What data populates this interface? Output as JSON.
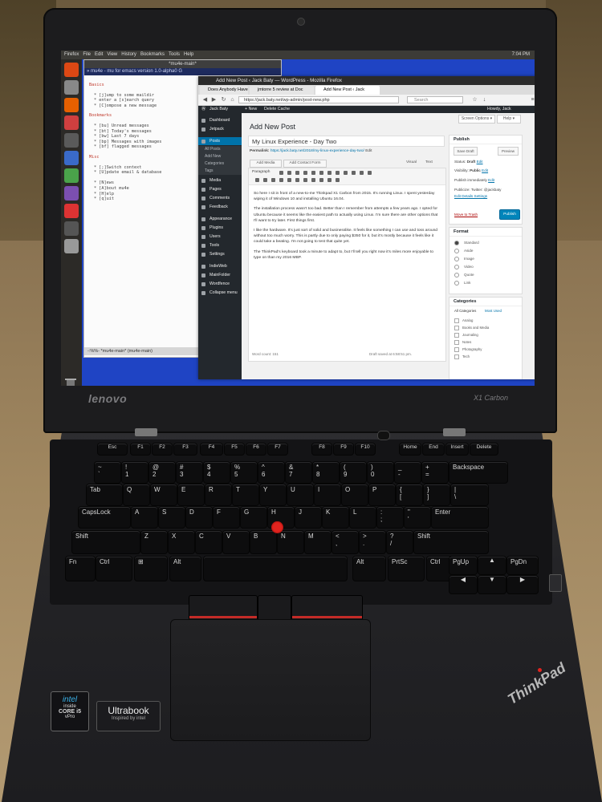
{
  "ubuntu": {
    "menu": [
      "Firefox",
      "File",
      "Edit",
      "View",
      "History",
      "Bookmarks",
      "Tools",
      "Help"
    ],
    "clock": "7:04 PM"
  },
  "emacs": {
    "title": "*mu4e-main*",
    "modeline_top": "» mu4e - mu for emacs version 1.0-alpha0 G",
    "basics_header": "Basics",
    "basics": [
      "* [j]ump to some maildir",
      "* enter a [s]earch query",
      "* [C]ompose a new message"
    ],
    "bookmarks_header": "Bookmarks",
    "bookmarks": [
      "* [bu] Unread messages",
      "* [bt] Today's messages",
      "* [bw] Last 7 days",
      "* [bp] Messages with images",
      "* [bf] flagged messages"
    ],
    "misc_header": "Misc",
    "misc": [
      "* [;]Switch context",
      "* [U]pdate email & database",
      "",
      "* [N]ews",
      "* [A]bout mu4e",
      "* [H]elp",
      "* [q]uit"
    ],
    "modeline_bottom": "-:%%-  *mu4e-main*     (mu4e-main)"
  },
  "firefox": {
    "window_title": "Add New Post ‹ Jack Baty — WordPress - Mozilla Firefox",
    "tabs": [
      "Does Anybody Have",
      "jmtorre 5 review at Doc",
      "Add New Post ‹ Jack"
    ],
    "url": "https://jack.baty.net/wp-admin/post-new.php",
    "search_placeholder": "Search"
  },
  "wp": {
    "adminbar": {
      "site": "Jack Baty",
      "new": "+ New",
      "delete": "Delete Cache",
      "howdy": "Howdy, Jack"
    },
    "sidebar": [
      {
        "label": "Dashboard",
        "active": false
      },
      {
        "label": "Jetpack",
        "active": false
      },
      {
        "label": "Posts",
        "active": true
      },
      {
        "label": "Media",
        "active": false
      },
      {
        "label": "Pages",
        "active": false
      },
      {
        "label": "Comments",
        "active": false
      },
      {
        "label": "Feedback",
        "active": false
      },
      {
        "label": "Appearance",
        "active": false
      },
      {
        "label": "Plugins",
        "active": false
      },
      {
        "label": "Users",
        "active": false
      },
      {
        "label": "Tools",
        "active": false
      },
      {
        "label": "Settings",
        "active": false
      },
      {
        "label": "IndieWeb",
        "active": false
      },
      {
        "label": "MainFolder",
        "active": false
      },
      {
        "label": "Wordfence",
        "active": false
      },
      {
        "label": "Collapse menu",
        "active": false
      }
    ],
    "posts_sub": [
      "All Posts",
      "Add New",
      "Categories",
      "Tags"
    ],
    "screen_options": "Screen Options ▾",
    "help": "Help ▾",
    "page_title": "Add New Post",
    "post_title": "My Linux Experience - Day Two",
    "permalink_label": "Permalink:",
    "permalink_url": "https://jack.baty.net/2018/my-linux-experience-day-two/",
    "permalink_edit": "Edit",
    "add_media": "Add Media",
    "add_contact": "Add Contact Form",
    "visual_tab": "Visual",
    "text_tab": "Text",
    "paragraph": "Paragraph",
    "content": [
      "So here I sit in front of a new-to-me Thinkpad X1 Carbon from 2015. It's running Linux. I spent yesterday wiping it of Windows 10 and installing Ubuntu 16.04.",
      "The installation process wasn't too bad. Better than I remember from attempts a few years ago. I opted for Ubuntu because it seems like the easiest path to actually using Linux. I'm sure there are other options that I'll want to try later. First things first.",
      "I like the hardware. It's just sort of solid and businesslike. It feels like something I can use and toss around without too much worry. This is partly due to only paying $350 for it, but it's mostly because it feels like it could take a beating. I'm not going to test that quite yet.",
      "The ThinkPad's keyboard took a minute to adapt to, but I'll tell you right now it's miles more enjoyable to type on than my 2016 MBP."
    ],
    "word_count": "Word count: 151",
    "draft_saved": "Draft saved at 6:58:51 pm.",
    "publish": {
      "title": "Publish",
      "save_draft": "Save Draft",
      "preview": "Preview",
      "status_label": "Status:",
      "status": "Draft",
      "status_edit": "Edit",
      "visibility_label": "Visibility:",
      "visibility": "Public",
      "visibility_edit": "Edit",
      "publish_when": "Publish immediately",
      "publish_edit": "Edit",
      "publicize": "Publicize: Twitter: @jackbaty",
      "edit_details": "Edit Details Settings",
      "trash": "Move to Trash",
      "publish_btn": "Publish"
    },
    "format": {
      "title": "Format",
      "options": [
        "Standard",
        "Aside",
        "Image",
        "Video",
        "Quote",
        "Link"
      ]
    },
    "categories": {
      "title": "Categories",
      "tab_all": "All Categories",
      "tab_most": "Most Used",
      "items": [
        "Analog",
        "Books and Media",
        "Journaling",
        "Notes",
        "Photography",
        "Tech"
      ]
    }
  },
  "laptop": {
    "brand": "lenovo",
    "model": "X1 Carbon",
    "thinkpad": "ThinkPad",
    "intel": {
      "brand": "intel",
      "inside": "inside",
      "core": "CORE i5",
      "vpro": "vPro"
    },
    "ultrabook": {
      "name": "Ultrabook",
      "inspired": "Inspired by intel"
    }
  },
  "keyboard": {
    "fn_row": [
      "Esc",
      "F1",
      "F2",
      "F3",
      "F4",
      "F5",
      "F6",
      "F7",
      "F8",
      "F9",
      "F10",
      "Home",
      "End",
      "Insert",
      "Delete"
    ],
    "row1": [
      "~\n`",
      "!\n1",
      "@\n2",
      "#\n3",
      "$\n4",
      "%\n5",
      "^\n6",
      "&\n7",
      "*\n8",
      "(\n9",
      ")\n0",
      "_\n-",
      "+\n=",
      "Backspace"
    ],
    "row2": [
      "Tab",
      "Q",
      "W",
      "E",
      "R",
      "T",
      "Y",
      "U",
      "I",
      "O",
      "P",
      "{\n[",
      "}\n]",
      "|\n\\"
    ],
    "row3": [
      "CapsLock",
      "A",
      "S",
      "D",
      "F",
      "G",
      "H",
      "J",
      "K",
      "L",
      ":\n;",
      "\"\n'",
      "Enter"
    ],
    "row4": [
      "Shift",
      "Z",
      "X",
      "C",
      "V",
      "B",
      "N",
      "M",
      "<\n,",
      ">\n.",
      "?\n/",
      "Shift"
    ],
    "row5": [
      "Fn",
      "Ctrl",
      "⊞",
      "Alt",
      "",
      "Alt",
      "PrtSc",
      "Ctrl"
    ],
    "nav": {
      "pgup": "PgUp",
      "pgdn": "PgDn",
      "up": "▲",
      "left": "◀",
      "down": "▼",
      "right": "▶"
    }
  },
  "colors": {
    "screen_bg": "#1f44c4",
    "wp_sidebar": "#23282d",
    "wp_active": "#0073aa",
    "publish_btn": "#0085ba",
    "trackpoint": "#e0241f"
  }
}
